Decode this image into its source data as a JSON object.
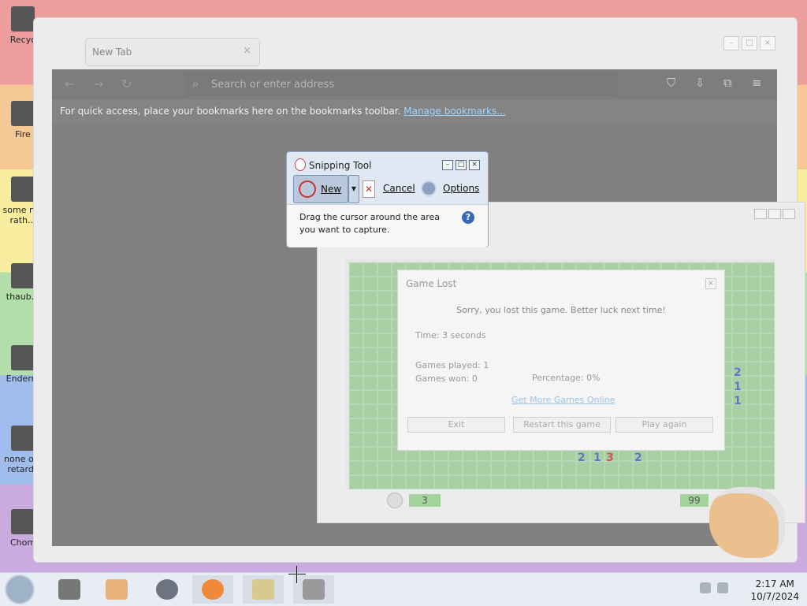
{
  "desktop": {
    "icons": [
      {
        "label": "Recyc"
      },
      {
        "label": "Fire"
      },
      {
        "label": "some n... rath..."
      },
      {
        "label": "thaub..."
      },
      {
        "label": "Enderm"
      },
      {
        "label": "none o... retards"
      },
      {
        "label": "Chom"
      }
    ]
  },
  "browser": {
    "tab_title": "New Tab",
    "tab_close": "×",
    "address_placeholder": "Search or enter address",
    "bookmarks_message": "For quick access, place your bookmarks here on the bookmarks toolbar.",
    "bookmarks_link": "Manage bookmarks..."
  },
  "snipping_tool": {
    "title": "Snipping Tool",
    "new_label": "New",
    "cancel_label": "Cancel",
    "options_label": "Options",
    "instruction": "Drag the cursor around the area you want to capture.",
    "help": "?"
  },
  "minesweeper": {
    "timer": "3",
    "mines_left": "99",
    "visible_numbers": [
      "2",
      "1",
      "1",
      "2",
      "1",
      "3",
      "2"
    ],
    "game_lost_dialog": {
      "title": "Game Lost",
      "close": "×",
      "message": "Sorry, you lost this game. Better luck next time!",
      "time": "Time: 3 seconds",
      "games_played": "Games played: 1",
      "games_won": "Games won: 0",
      "percentage": "Percentage: 0%",
      "more_games_link": "Get More Games Online",
      "buttons": {
        "exit": "Exit",
        "restart": "Restart this game",
        "play_again": "Play again"
      }
    }
  },
  "taskbar": {
    "time": "2:17 AM",
    "date": "10/7/2024"
  }
}
